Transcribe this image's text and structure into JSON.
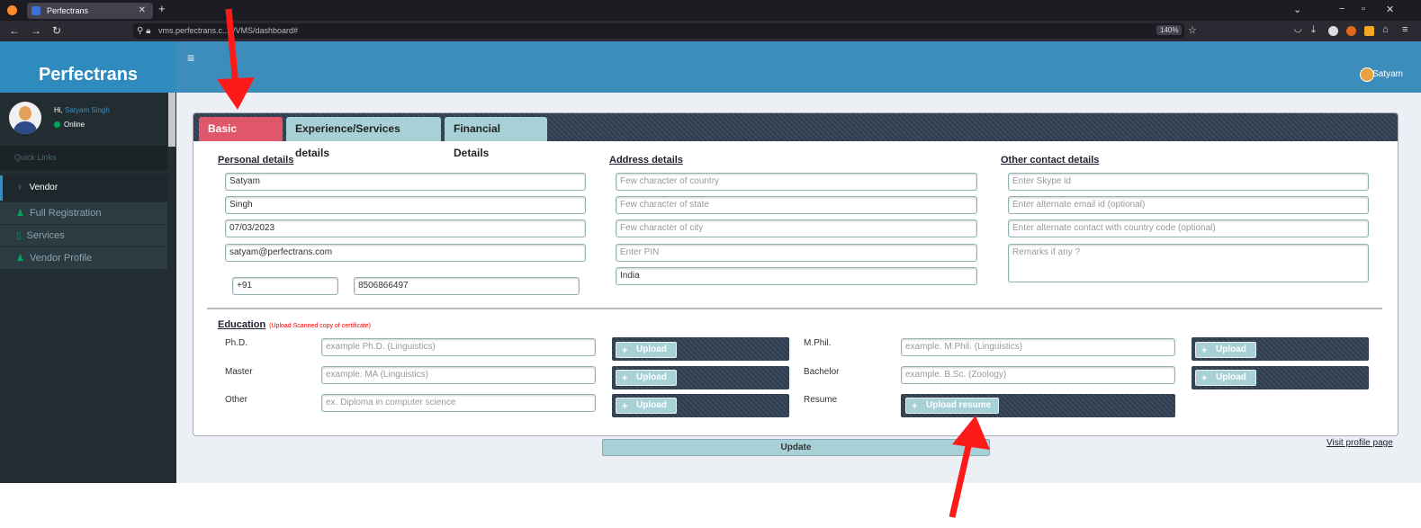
{
  "browser": {
    "tab_title": "Perfectrans",
    "url": "vms.perfectrans.c...y/VMS/dashboard#",
    "zoom": "140%"
  },
  "app": {
    "brand": "Perfectrans",
    "menu_icon": "≡",
    "top_user": "Satyam"
  },
  "sidebar": {
    "greeting_prefix": "Hi,",
    "greeting_name": "Satyam Singh",
    "status": "Online",
    "quick_links": "Quick Links",
    "vendor": "Vendor",
    "items": [
      {
        "label": "Full Registration",
        "icon": "user-icon"
      },
      {
        "label": "Services",
        "icon": "bookmark-icon"
      },
      {
        "label": "Vendor Profile",
        "icon": "user-icon"
      }
    ]
  },
  "tabs": [
    "Basic details",
    "Experience/Services details",
    "Financial Details"
  ],
  "personal": {
    "heading": "Personal details",
    "first_name": "Satyam",
    "last_name": "Singh",
    "dob": "07/03/2023",
    "email": "satyam@perfectrans.com",
    "country_code": "+91",
    "phone": "8506866497"
  },
  "address": {
    "heading": "Address details",
    "country_ph": "Few character of country",
    "state_ph": "Few character of state",
    "city_ph": "Few character of city",
    "pin_ph": "Enter PIN",
    "country_value": "India"
  },
  "other": {
    "heading": "Other contact details",
    "skype_ph": "Enter Skype id",
    "alt_email_ph": "Enter alternate email id (optional)",
    "alt_contact_ph": "Enter alternate contact with country code (optional)",
    "remarks_ph": "Remarks if any ?"
  },
  "education": {
    "heading": "Education",
    "note": "(Upload Scanned copy of certificate)",
    "phd_label": "Ph.D.",
    "phd_ph": "example Ph.D. (Linguistics)",
    "master_label": "Master",
    "master_ph": "example. MA (Linguistics)",
    "other_label": "Other",
    "other_ph": "ex. Diploma in computer science",
    "mphil_label": "M.Phil.",
    "mphil_ph": "example. M.Phil. (Linguistics)",
    "bachelor_label": "Bachelor",
    "bachelor_ph": "example. B.Sc. (Zoology)",
    "resume_label": "Resume",
    "upload": "Upload",
    "upload_resume": "Upload resume"
  },
  "footer": {
    "update": "Update",
    "visit": "Visit profile page"
  },
  "colors": {
    "header": "#3c8dbc",
    "sidebar": "#222d32",
    "active_tab": "#e0566a",
    "tab": "#a7d1d6",
    "arrow": "#ff1a1a"
  }
}
